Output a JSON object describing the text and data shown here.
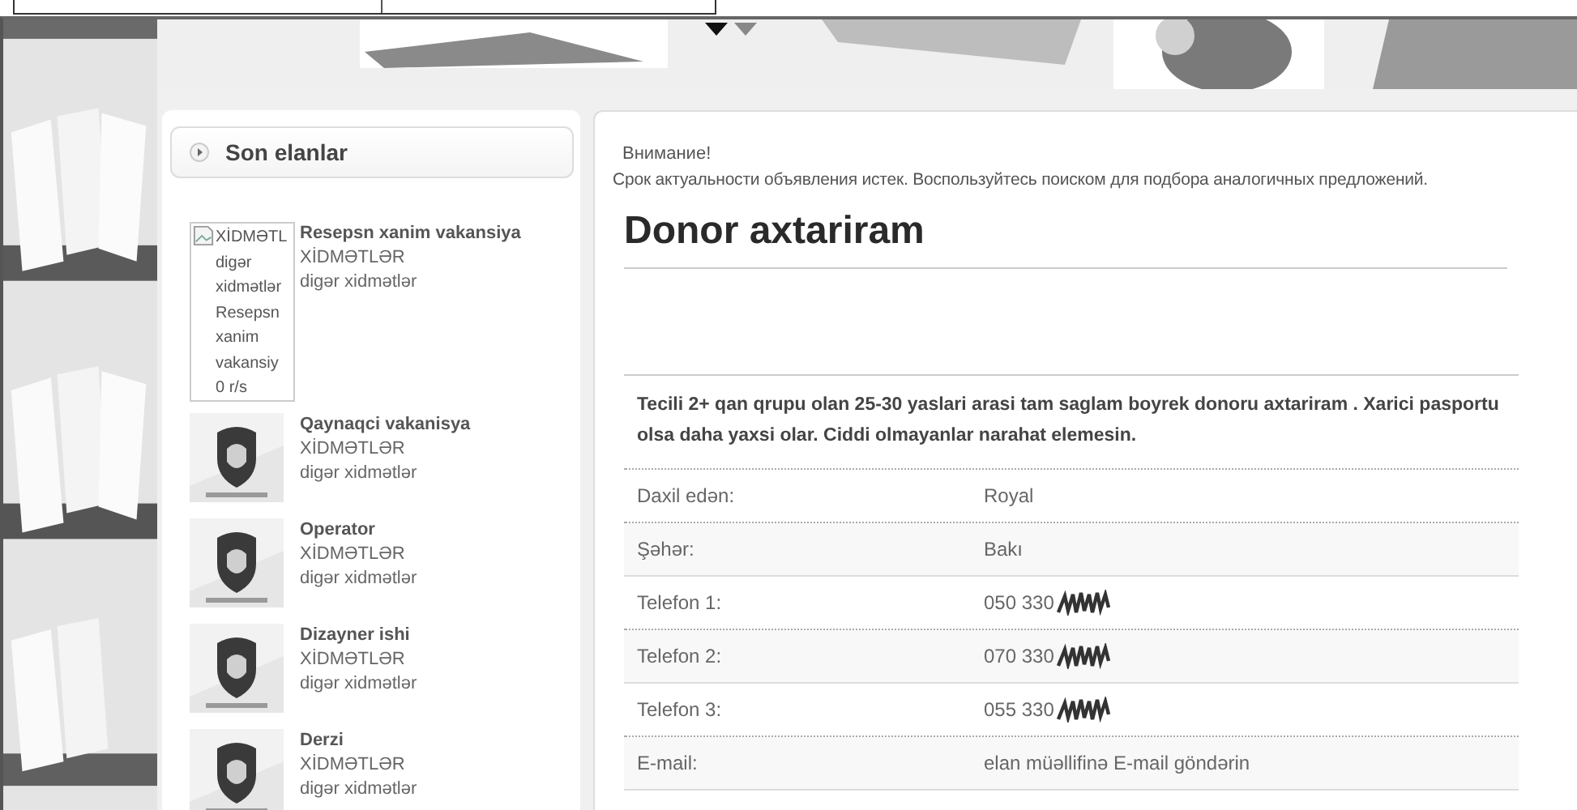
{
  "sidebar": {
    "title": "Son elanlar",
    "items": [
      {
        "kind": "broken-image",
        "alt": "XİDMƏTL\ndigər\nxidmətlər\nResepsn\nxanim\nvakansiy\n0 r/s",
        "title": "Resepsn xanim vakansiya",
        "category": "XİDMƏTLƏR",
        "subcategory": "digər xidmətlər"
      },
      {
        "kind": "picture",
        "title": "Qaynaqci vakanisya",
        "category": "XİDMƏTLƏR",
        "subcategory": "digər xidmətlər"
      },
      {
        "kind": "picture",
        "title": "Operator",
        "category": "XİDMƏTLƏR",
        "subcategory": "digər xidmətlər"
      },
      {
        "kind": "picture",
        "title": "Dizayner ishi",
        "category": "XİDMƏTLƏR",
        "subcategory": "digər xidmətlər"
      },
      {
        "kind": "picture",
        "title": "Derzi",
        "category": "XİDMƏTLƏR",
        "subcategory": "digər xidmətlər"
      }
    ]
  },
  "notice": {
    "heading": "Внимание!",
    "text": "Срок актуальности объявления истек. Воспользуйтесь поиском для подбора аналогичных предложений."
  },
  "ad": {
    "title": "Donor axtariram",
    "description": "Tecili 2+ qan qrupu olan 25-30 yaslari arasi tam saglam boyrek donoru axtariram . Xarici pasportu olsa daha yaxsi olar. Ciddi olmayanlar narahat elemesin.",
    "details": [
      {
        "label": "Daxil edən:",
        "value": "Royal",
        "redacted": false
      },
      {
        "label": "Şəhər:",
        "value": "Bakı",
        "redacted": false
      },
      {
        "label": "Telefon 1:",
        "value": "050 330",
        "redacted": true
      },
      {
        "label": "Telefon 2:",
        "value": "070 330",
        "redacted": true
      },
      {
        "label": "Telefon 3:",
        "value": "055 330",
        "redacted": true
      },
      {
        "label": "E-mail:",
        "value": "elan müəllifinə E-mail göndərin",
        "redacted": false
      }
    ]
  }
}
